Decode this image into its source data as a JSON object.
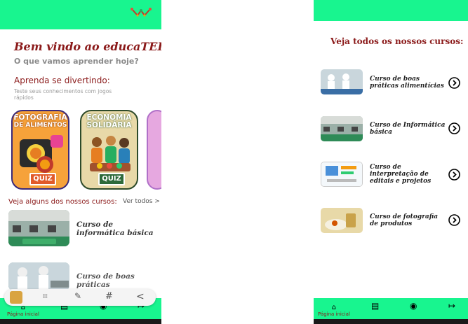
{
  "left_screen": {
    "welcome": "Bem vindo ao educaTEIAS!",
    "subtitle": "O que vamos aprender hoje?",
    "fun_title": "Aprenda se divertindo:",
    "fun_desc": "Teste seus conhecimentos com jogos rápidos",
    "quizzes": [
      {
        "title_line1": "FOTOGRAFIA",
        "title_line2": "DE ALIMENTOS",
        "badge": "QUIZ"
      },
      {
        "title_line1": "ECONOMIA",
        "title_line2": "SOLIDÁRIA",
        "badge": "QUIZ"
      }
    ],
    "courses_heading": "Veja alguns dos nossos cursos:",
    "see_all": "Ver todos >",
    "courses": [
      {
        "title": "Curso de informática básica"
      },
      {
        "title": "Curso de boas práticas alimentícias"
      }
    ],
    "share_icons": [
      "app-thumbnail-icon",
      "scan-icon",
      "edit-icon",
      "hashtag-icon",
      "share-icon"
    ],
    "nav": {
      "home_label": "Página inicial"
    }
  },
  "right_screen": {
    "title": "Veja todos os nossos cursos:",
    "courses": [
      {
        "title": "Curso de boas práticas alimentícias"
      },
      {
        "title": "Curso de Informática básica"
      },
      {
        "title": "Curso de interpretação de editais e projetos"
      },
      {
        "title": "Curso de fotografia de produtos"
      }
    ],
    "nav": {
      "home_label": "Página inicial"
    }
  },
  "colors": {
    "accent_green": "#18f58f",
    "title_red": "#8b1a1a"
  }
}
